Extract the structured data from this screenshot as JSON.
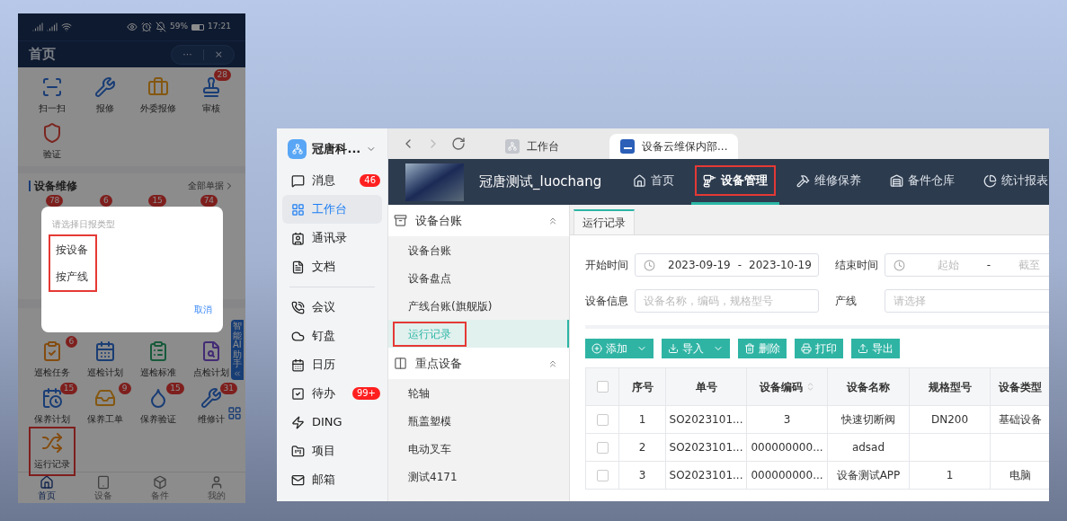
{
  "phone": {
    "status_bar": {
      "battery": "59%",
      "time": "17:21"
    },
    "header": {
      "title": "首页",
      "more": "···",
      "close": "×"
    },
    "quick_actions": [
      {
        "label": "扫一扫",
        "kind": "scan"
      },
      {
        "label": "报修",
        "kind": "wrench"
      },
      {
        "label": "外委报修",
        "kind": "briefcase"
      },
      {
        "label": "审核",
        "kind": "stamp",
        "badge": "28"
      },
      {
        "label": "验证",
        "kind": "shield"
      }
    ],
    "repair_section": {
      "title": "设备维修",
      "link": "全部单据",
      "badges": [
        "78",
        "6",
        "15",
        "74"
      ]
    },
    "plan_items": [
      {
        "label": "巡检任务",
        "kind": "task",
        "badge": "6",
        "highlighted": false
      },
      {
        "label": "巡检计划",
        "kind": "calendar",
        "highlighted": false
      },
      {
        "label": "巡检标准",
        "kind": "clipboard",
        "highlighted": false
      },
      {
        "label": "点检计划",
        "kind": "search-doc",
        "highlighted": false
      },
      {
        "label": "保养计划",
        "kind": "calendar-clock",
        "badge": "15",
        "highlighted": false
      },
      {
        "label": "保养工单",
        "kind": "inbox",
        "badge": "9",
        "highlighted": false
      },
      {
        "label": "保养验证",
        "kind": "droplet",
        "badge": "15",
        "highlighted": false
      },
      {
        "label": "维修计",
        "kind": "wrench",
        "badge": "31",
        "highlighted": false
      },
      {
        "label": "运行记录",
        "kind": "shuffle",
        "highlighted": true
      }
    ],
    "ai_tab": "智能AI助手",
    "bottom_nav": [
      {
        "label": "首页",
        "kind": "home",
        "selected": true
      },
      {
        "label": "设备",
        "kind": "tablet",
        "selected": false
      },
      {
        "label": "备件",
        "kind": "box",
        "selected": false
      },
      {
        "label": "我的",
        "kind": "user",
        "selected": false
      }
    ],
    "dialog": {
      "title": "请选择日报类型",
      "options": [
        "按设备",
        "按产线"
      ],
      "options_highlighted": true,
      "cancel": "取消"
    }
  },
  "desktop": {
    "rail": {
      "org": "冠唐科...",
      "primary": [
        {
          "label": "消息",
          "kind": "message",
          "badge": "46",
          "selected": false
        },
        {
          "label": "工作台",
          "kind": "grid",
          "selected": true
        },
        {
          "label": "通讯录",
          "kind": "contacts",
          "selected": false
        },
        {
          "label": "文档",
          "kind": "doc",
          "selected": false
        }
      ],
      "secondary": [
        {
          "label": "会议",
          "kind": "phone",
          "selected": false
        },
        {
          "label": "钉盘",
          "kind": "cloud",
          "selected": false
        },
        {
          "label": "日历",
          "kind": "calendar",
          "selected": false
        },
        {
          "label": "待办",
          "kind": "check",
          "badge": "99+",
          "selected": false
        },
        {
          "label": "DING",
          "kind": "zap",
          "selected": false
        },
        {
          "label": "项目",
          "kind": "project",
          "selected": false
        },
        {
          "label": "邮箱",
          "kind": "mail",
          "selected": false
        }
      ]
    },
    "tabs": [
      {
        "label": "工作台",
        "kind": "org",
        "selected": false
      },
      {
        "label": "设备云维保内部...",
        "kind": "word",
        "selected": true
      }
    ],
    "header": {
      "title": "冠唐测试_luochang",
      "nav": [
        {
          "label": "首页",
          "kind": "home",
          "selected": false,
          "highlighted": false
        },
        {
          "label": "设备管理",
          "kind": "drill",
          "selected": true,
          "highlighted": true
        },
        {
          "label": "维修保养",
          "kind": "tools",
          "selected": false,
          "highlighted": false
        },
        {
          "label": "备件仓库",
          "kind": "warehouse",
          "selected": false,
          "highlighted": false
        },
        {
          "label": "统计报表",
          "kind": "pie",
          "selected": false,
          "highlighted": false
        }
      ]
    },
    "menu": [
      {
        "label": "设备台账",
        "kind": "ledger",
        "expanded": true,
        "children": [
          {
            "label": "设备台账",
            "selected": false,
            "highlighted": false
          },
          {
            "label": "设备盘点",
            "selected": false,
            "highlighted": false
          },
          {
            "label": "产线台账(旗舰版)",
            "selected": false,
            "highlighted": false
          },
          {
            "label": "运行记录",
            "selected": true,
            "highlighted": true
          }
        ]
      },
      {
        "label": "重点设备",
        "kind": "panel",
        "expanded": true,
        "children": [
          {
            "label": "轮轴",
            "selected": false,
            "highlighted": false
          },
          {
            "label": "瓶盖塑模",
            "selected": false,
            "highlighted": false
          },
          {
            "label": "电动叉车",
            "selected": false,
            "highlighted": false
          },
          {
            "label": "测试4171",
            "selected": false,
            "highlighted": false
          }
        ]
      }
    ],
    "page_tab": "运行记录",
    "filters": [
      {
        "label": "开始时间",
        "kind": "range",
        "from": "2023-09-19",
        "to": "2023-10-19",
        "separator": "-"
      },
      {
        "label": "结束时间",
        "kind": "range",
        "from_placeholder": "起始",
        "to_placeholder": "截至",
        "separator": "-"
      },
      {
        "label": "设备信息",
        "kind": "text",
        "placeholder": "设备名称，编码，规格型号"
      },
      {
        "label": "产线",
        "kind": "select",
        "placeholder": "请选择"
      }
    ],
    "actions": [
      {
        "label": "添加",
        "kind": "add",
        "dropdown": true
      },
      {
        "label": "导入",
        "kind": "import",
        "dropdown": true
      },
      {
        "label": "删除",
        "kind": "delete",
        "dropdown": false
      },
      {
        "label": "打印",
        "kind": "print",
        "dropdown": false
      },
      {
        "label": "导出",
        "kind": "export",
        "dropdown": false
      }
    ],
    "table": {
      "all_checked": false,
      "columns": [
        {
          "label": "序号",
          "sortable": false
        },
        {
          "label": "单号",
          "sortable": false
        },
        {
          "label": "设备编码",
          "sortable": true
        },
        {
          "label": "设备名称",
          "sortable": false
        },
        {
          "label": "规格型号",
          "sortable": false
        },
        {
          "label": "设备类型",
          "sortable": false
        }
      ],
      "rows": [
        {
          "checked": false,
          "cells": [
            "1",
            "SO2023101...",
            "3",
            "快速切断阀",
            "DN200",
            "基础设备"
          ]
        },
        {
          "checked": false,
          "cells": [
            "2",
            "SO2023101...",
            "000000000...",
            "adsad",
            "",
            ""
          ]
        },
        {
          "checked": false,
          "cells": [
            "3",
            "SO2023101...",
            "000000000...",
            "设备测试APP",
            "1",
            "电脑"
          ]
        }
      ]
    }
  }
}
